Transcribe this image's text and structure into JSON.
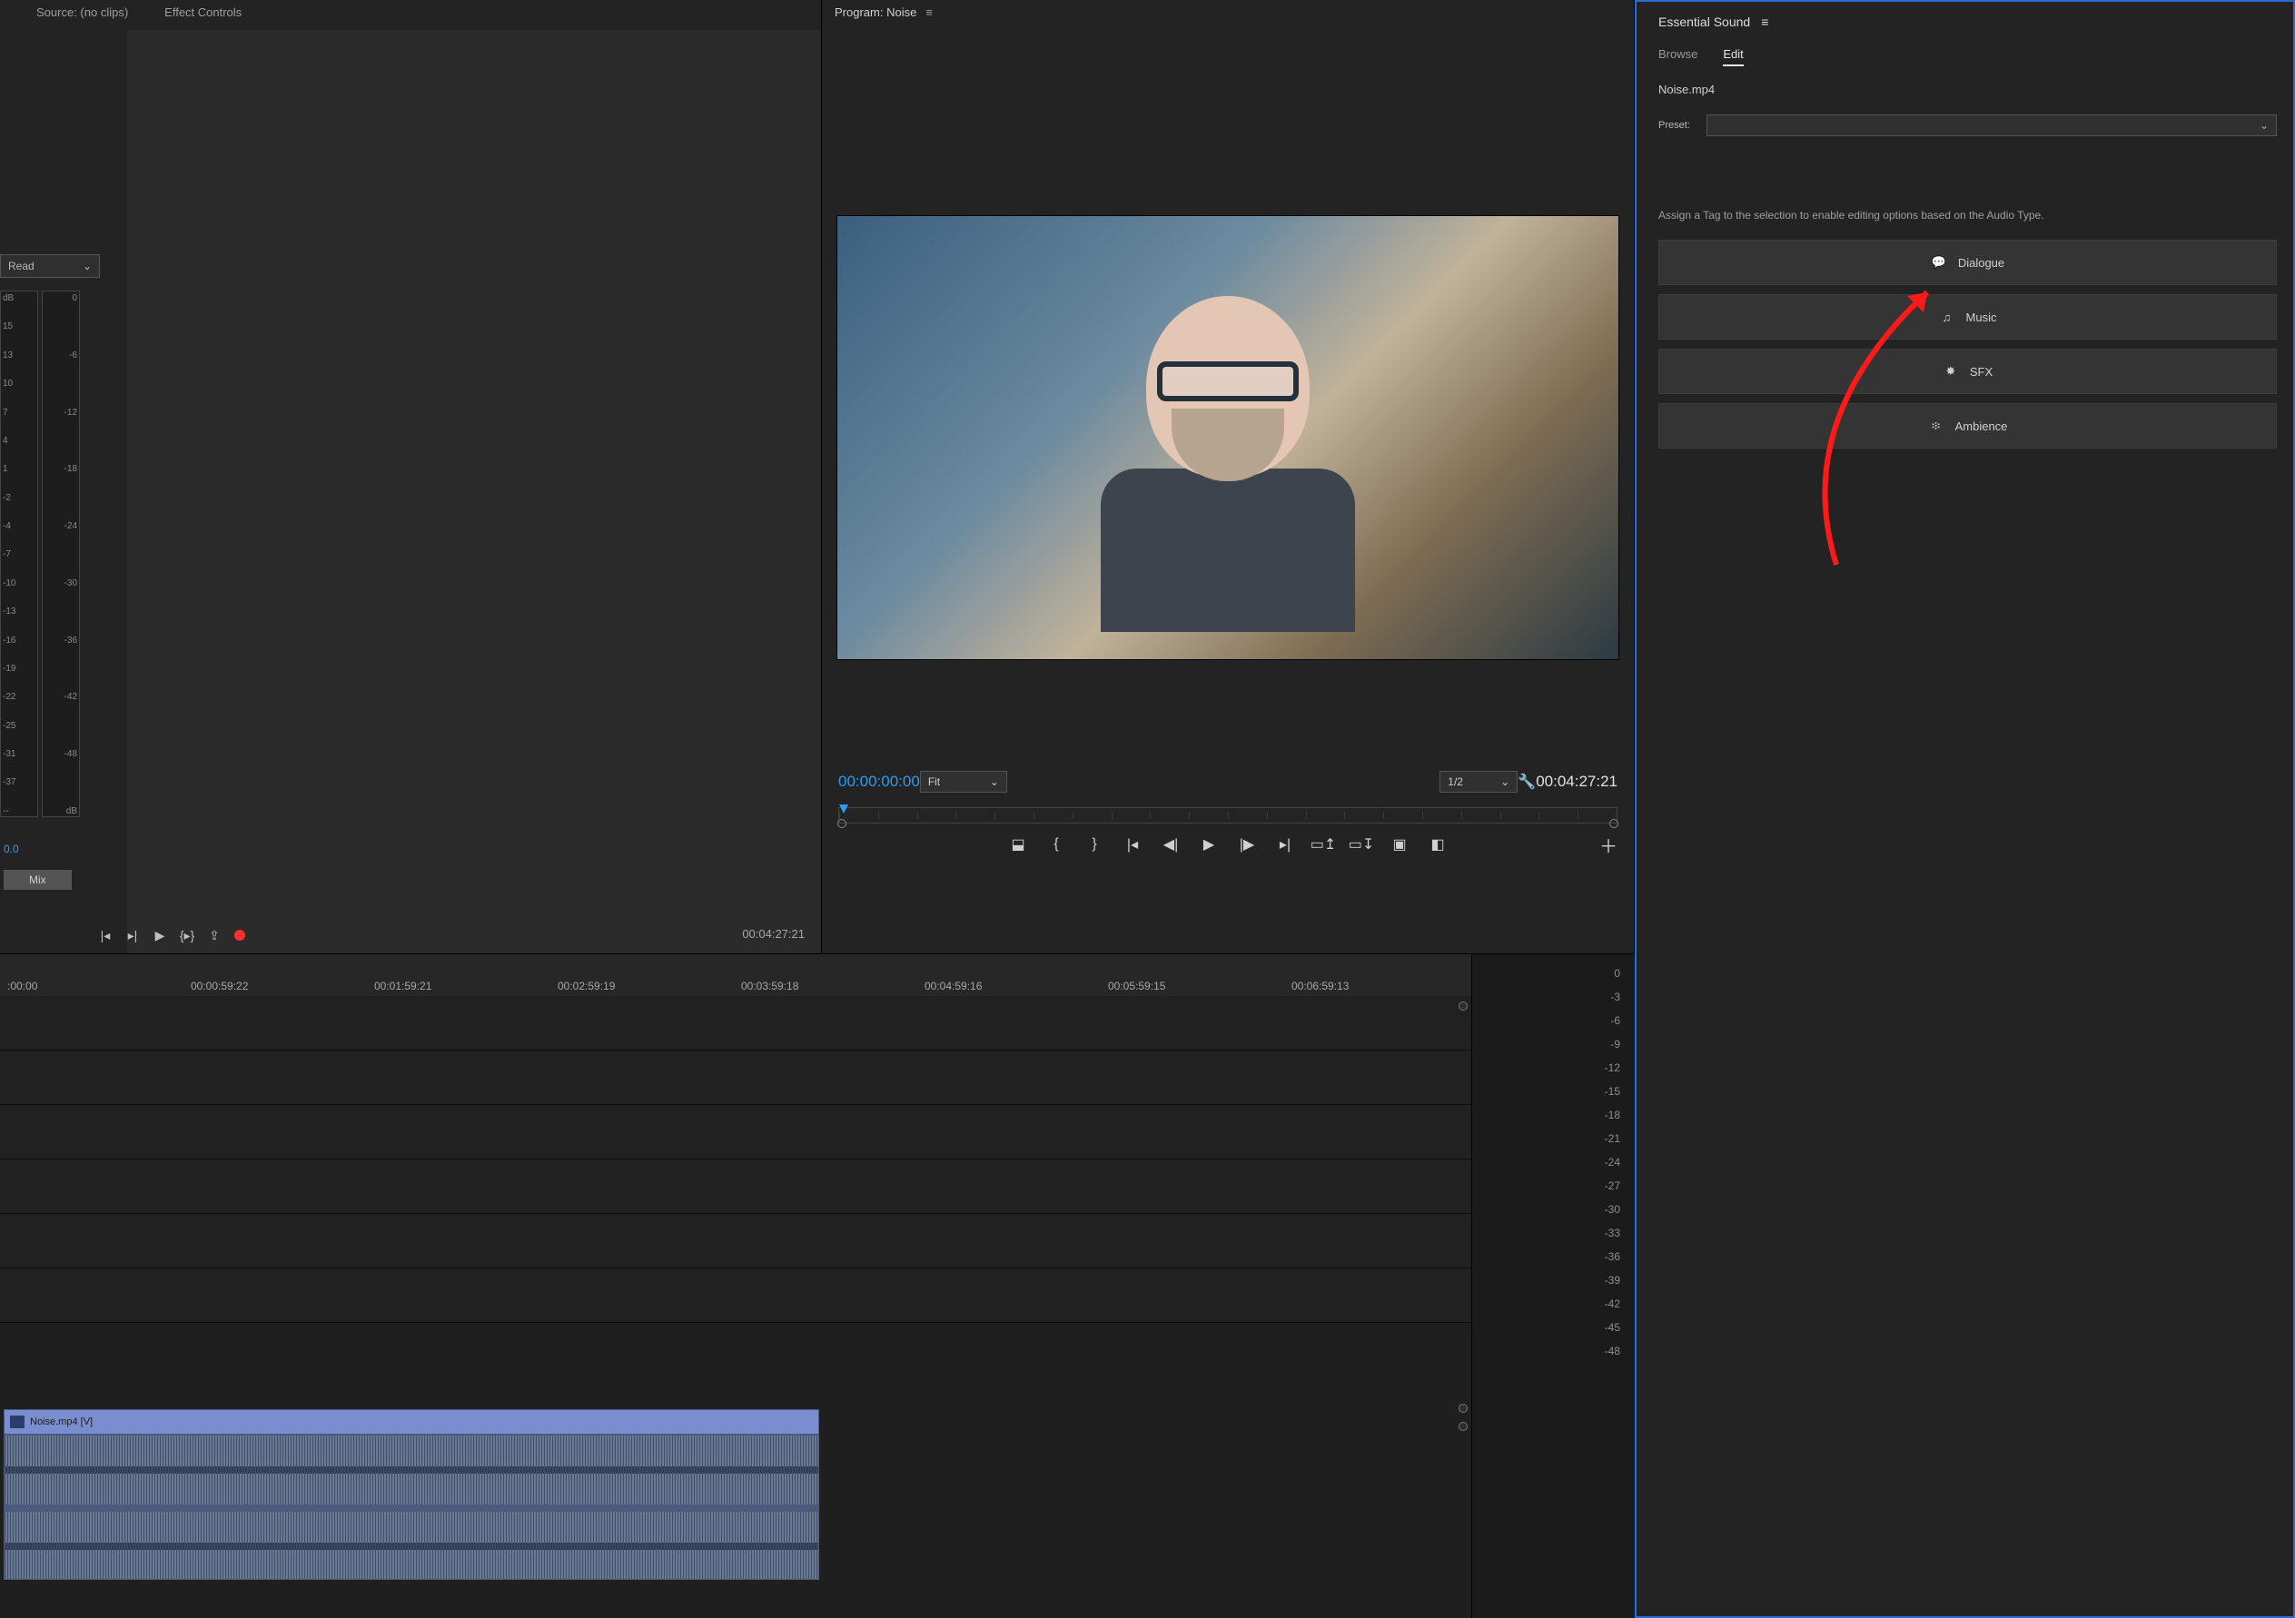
{
  "source_panel": {
    "tab_source": "Source: (no clips)",
    "tab_effect": "Effect Controls",
    "read_label": "Read",
    "meter_labels_left": [
      "dB",
      "15",
      "13",
      "10",
      "7",
      "4",
      "1",
      "-2",
      "-4",
      "-7",
      "-10",
      "-13",
      "-16",
      "-19",
      "-22",
      "-25",
      "-31",
      "-37",
      "--"
    ],
    "meter_labels_right": [
      "0",
      "",
      "-6",
      "",
      "-12",
      "",
      "-18",
      "",
      "-24",
      "",
      "-30",
      "",
      "-36",
      "",
      "-42",
      "",
      "-48",
      "",
      "dB"
    ],
    "clip_zero": "0.0",
    "mix": "Mix",
    "duration": "00:04:27:21"
  },
  "program_panel": {
    "title": "Program: Noise",
    "timecode": "00:00:00:00",
    "fit": "Fit",
    "resolution": "1/2",
    "duration": "00:04:27:21"
  },
  "essential_sound": {
    "title": "Essential Sound",
    "tab_browse": "Browse",
    "tab_edit": "Edit",
    "selected_file": "Noise.mp4",
    "preset_label": "Preset:",
    "tag_hint": "Assign a Tag to the selection to enable editing options based on the Audio Type.",
    "tags": {
      "dialogue": "Dialogue",
      "music": "Music",
      "sfx": "SFX",
      "ambience": "Ambience"
    }
  },
  "timeline": {
    "ruler": [
      ":00:00",
      "00:00:59:22",
      "00:01:59:21",
      "00:02:59:19",
      "00:03:59:18",
      "00:04:59:16",
      "00:05:59:15",
      "00:06:59:13"
    ],
    "video_clip_label": "Noise.mp4 [V]",
    "db_scale": [
      "0",
      "-3",
      "-6",
      "-9",
      "-12",
      "-15",
      "-18",
      "-21",
      "-24",
      "-27",
      "-30",
      "-33",
      "-36",
      "-39",
      "-42",
      "-45",
      "-48"
    ]
  }
}
